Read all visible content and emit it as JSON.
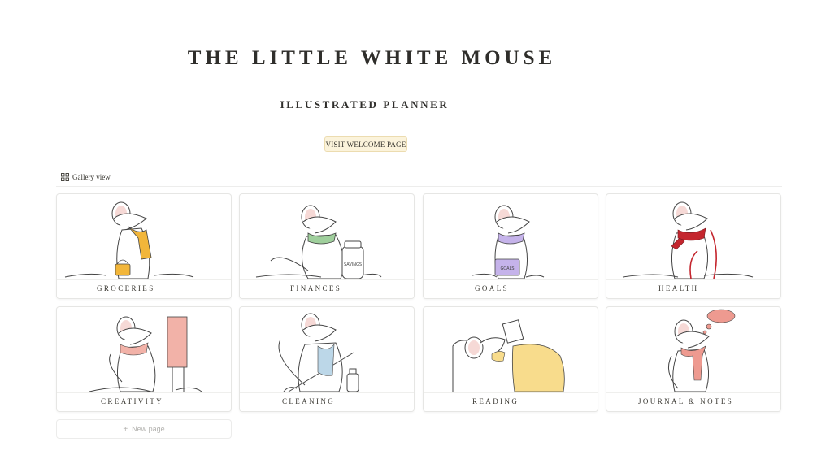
{
  "header": {
    "title": "THE LITTLE WHITE MOUSE",
    "subtitle": "ILLUSTRATED PLANNER"
  },
  "welcome_button": {
    "label": "VISIT WELCOME PAGE"
  },
  "view_tab": {
    "label": "Gallery view",
    "icon": "gallery-grid-icon"
  },
  "cards": [
    {
      "label": "GROCERIES",
      "illustration": "mouse-with-shopping-basket",
      "accent": "#f2b63a"
    },
    {
      "label": "FINANCES",
      "illustration": "mouse-with-savings-jar",
      "accent": "#9fcf9c",
      "jar_text": "SAVINGS"
    },
    {
      "label": "GOALS",
      "illustration": "mouse-with-goals-bag",
      "accent": "#c5b3ea",
      "bag_text": "GOALS"
    },
    {
      "label": "HEALTH",
      "illustration": "mouse-with-jump-rope",
      "accent": "#c4262e"
    },
    {
      "label": "CREATIVITY",
      "illustration": "mouse-painting-canvas",
      "accent": "#f2b2a8"
    },
    {
      "label": "CLEANING",
      "illustration": "mouse-with-mop",
      "accent": "#bcd7e8"
    },
    {
      "label": "READING",
      "illustration": "mouse-reading-in-bed",
      "accent": "#f8dc8c"
    },
    {
      "label": "JOURNAL & NOTES",
      "illustration": "mouse-thinking",
      "accent": "#ee9a90"
    }
  ],
  "new_page": {
    "label": "New page",
    "icon": "plus-icon"
  }
}
